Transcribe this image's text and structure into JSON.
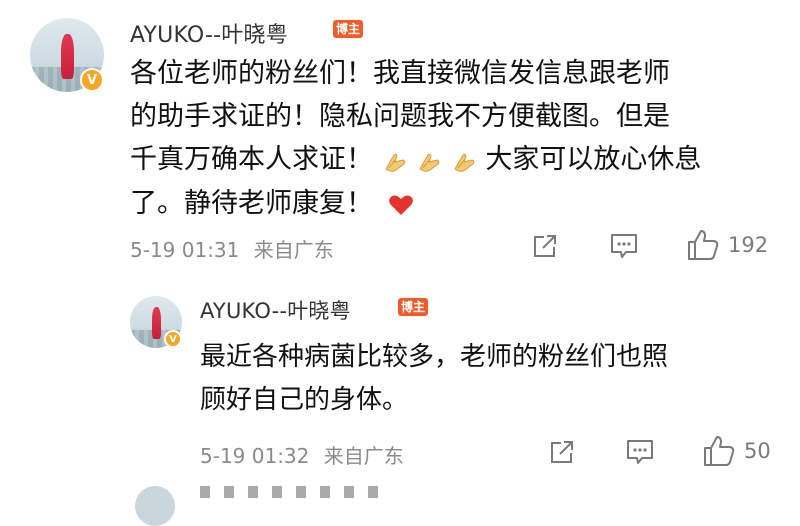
{
  "comments": [
    {
      "username": "AYUKO--叶晓粤",
      "badge": "博主",
      "text_line1": "各位老师的粉丝们！我直接微信发信息跟老师",
      "text_line2": "的助手求证的！隐私问题我不方便截图。但是",
      "text_line3a": "千真万确本人求证！",
      "text_line3b": "大家可以放心休息",
      "text_line4": "了。静待老师康复！",
      "timestamp": "5-19 01:31",
      "location": "来自广东",
      "likes": "192"
    },
    {
      "username": "AYUKO--叶晓粤",
      "badge": "博主",
      "text_line1": "最近各种病菌比较多，老师的粉丝们也照",
      "text_line2": "顾好自己的身体。",
      "timestamp": "5-19 01:32",
      "location": "来自广东",
      "likes": "50"
    }
  ],
  "icons": {
    "share": "share-icon",
    "comment": "comment-icon",
    "like": "thumbs-up-icon",
    "clap": "clapping-hands-icon",
    "heart": "red-heart-icon",
    "verified": "verified-v-icon"
  },
  "colors": {
    "badge": "#f25b2a",
    "verified": "#f5a623",
    "heart": "#e5322d",
    "meta_text": "#8a8a8a"
  }
}
